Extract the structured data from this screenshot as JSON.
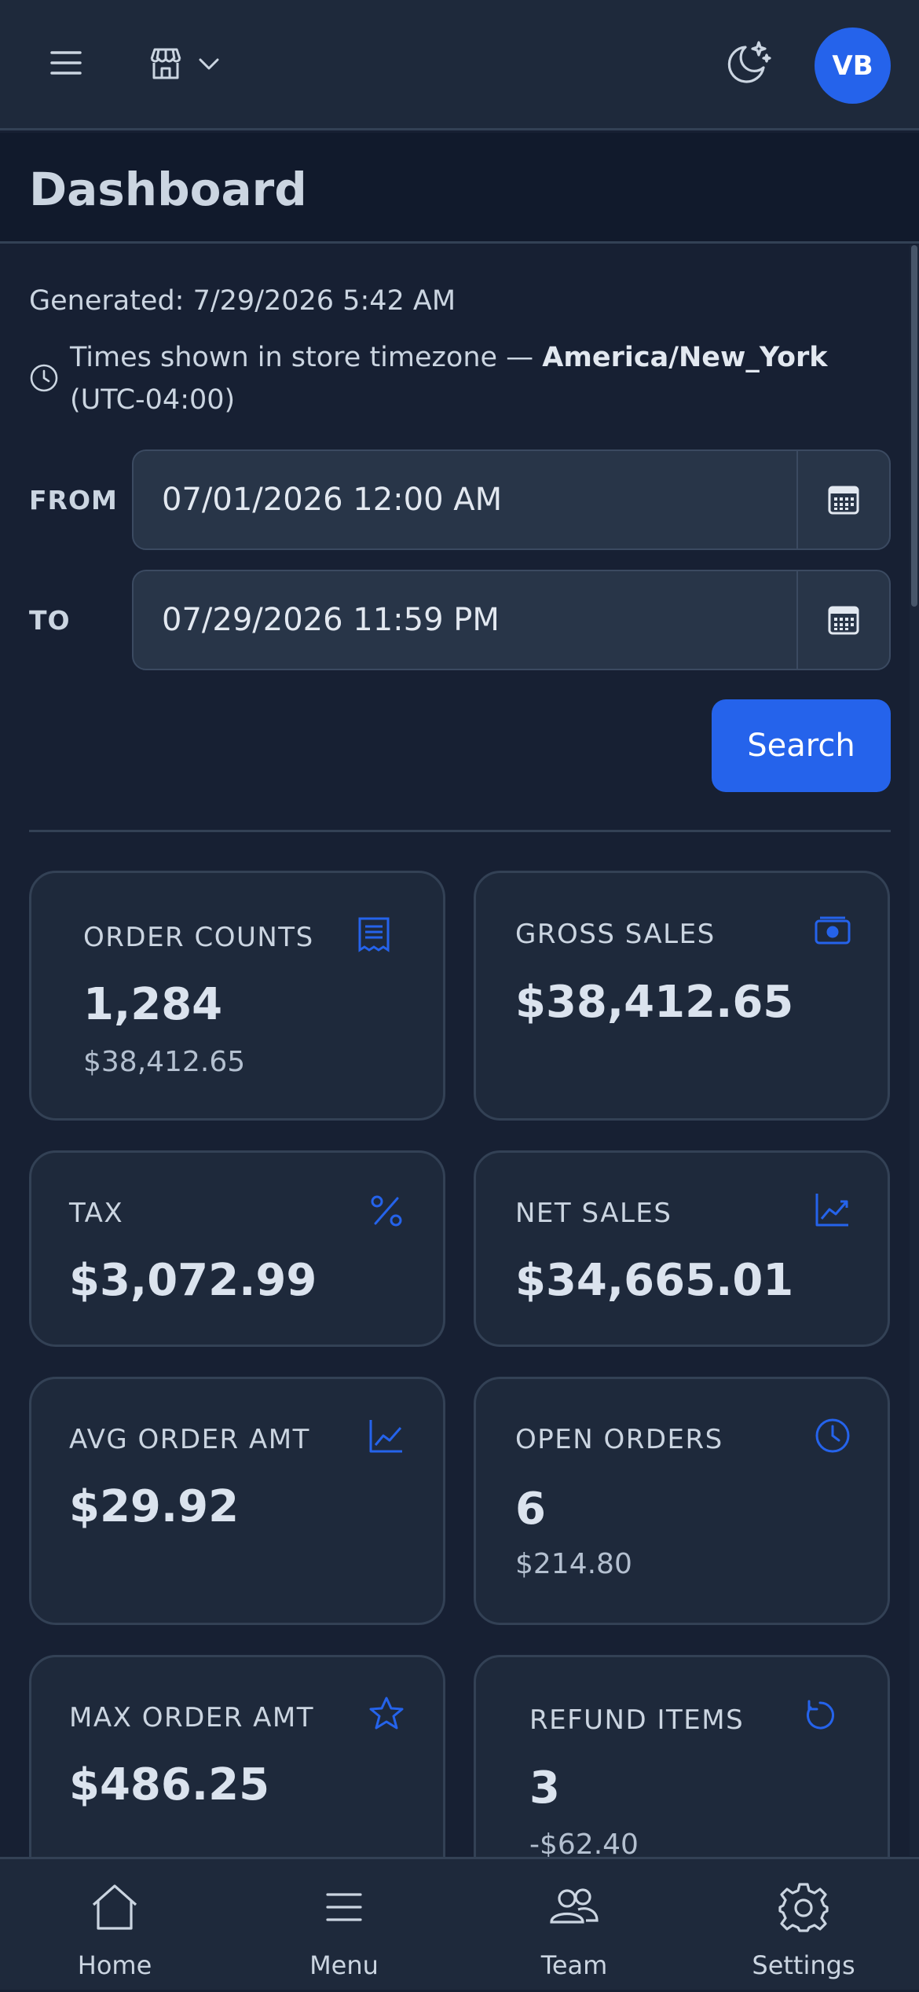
{
  "topbar": {
    "avatar_initials": "VB",
    "icons": {
      "menu": "hamburger-icon",
      "store": "store-icon",
      "store_chevron": "chevron-down-icon",
      "theme": "moon-stars-icon"
    }
  },
  "page": {
    "title": "Dashboard"
  },
  "info": {
    "generated": "Generated: 7/29/2026 5:42 AM",
    "timezone_prefix": "Times shown in store timezone — ",
    "timezone_name": "America/New_York",
    "timezone_offset": " (UTC-04:00)"
  },
  "filters": {
    "from_label": "FROM",
    "from_value": "07/01/2026 12:00 AM",
    "to_label": "TO",
    "to_value": "07/29/2026 11:59 PM",
    "search_label": "Search"
  },
  "cards": [
    {
      "label": "ORDER COUNTS",
      "value": "1,284",
      "sub": "$38,412.65",
      "icon": "receipt-icon"
    },
    {
      "label": "GROSS SALES",
      "value": "$38,412.65",
      "sub": "",
      "icon": "cash-icon"
    },
    {
      "label": "TAX",
      "value": "$3,072.99",
      "sub": "",
      "icon": "percent-icon"
    },
    {
      "label": "NET SALES",
      "value": "$34,665.01",
      "sub": "",
      "icon": "trending-up-icon"
    },
    {
      "label": "AVG ORDER AMT",
      "value": "$29.92",
      "sub": "",
      "icon": "line-chart-icon"
    },
    {
      "label": "OPEN ORDERS",
      "value": "6",
      "sub": "$214.80",
      "icon": "clock-icon"
    },
    {
      "label": "MAX ORDER AMT",
      "value": "$486.25",
      "sub": "",
      "icon": "star-icon"
    },
    {
      "label": "REFUND ITEMS",
      "value": "3",
      "sub": "-$62.40",
      "icon": "refresh-icon"
    }
  ],
  "nav": [
    {
      "label": "Home",
      "icon": "home-icon"
    },
    {
      "label": "Menu",
      "icon": "menu-icon"
    },
    {
      "label": "Team",
      "icon": "team-icon"
    },
    {
      "label": "Settings",
      "icon": "settings-icon"
    }
  ],
  "colors": {
    "accent": "#2563eb",
    "background": "#172033",
    "surface": "#1e293b",
    "border": "#334155"
  }
}
